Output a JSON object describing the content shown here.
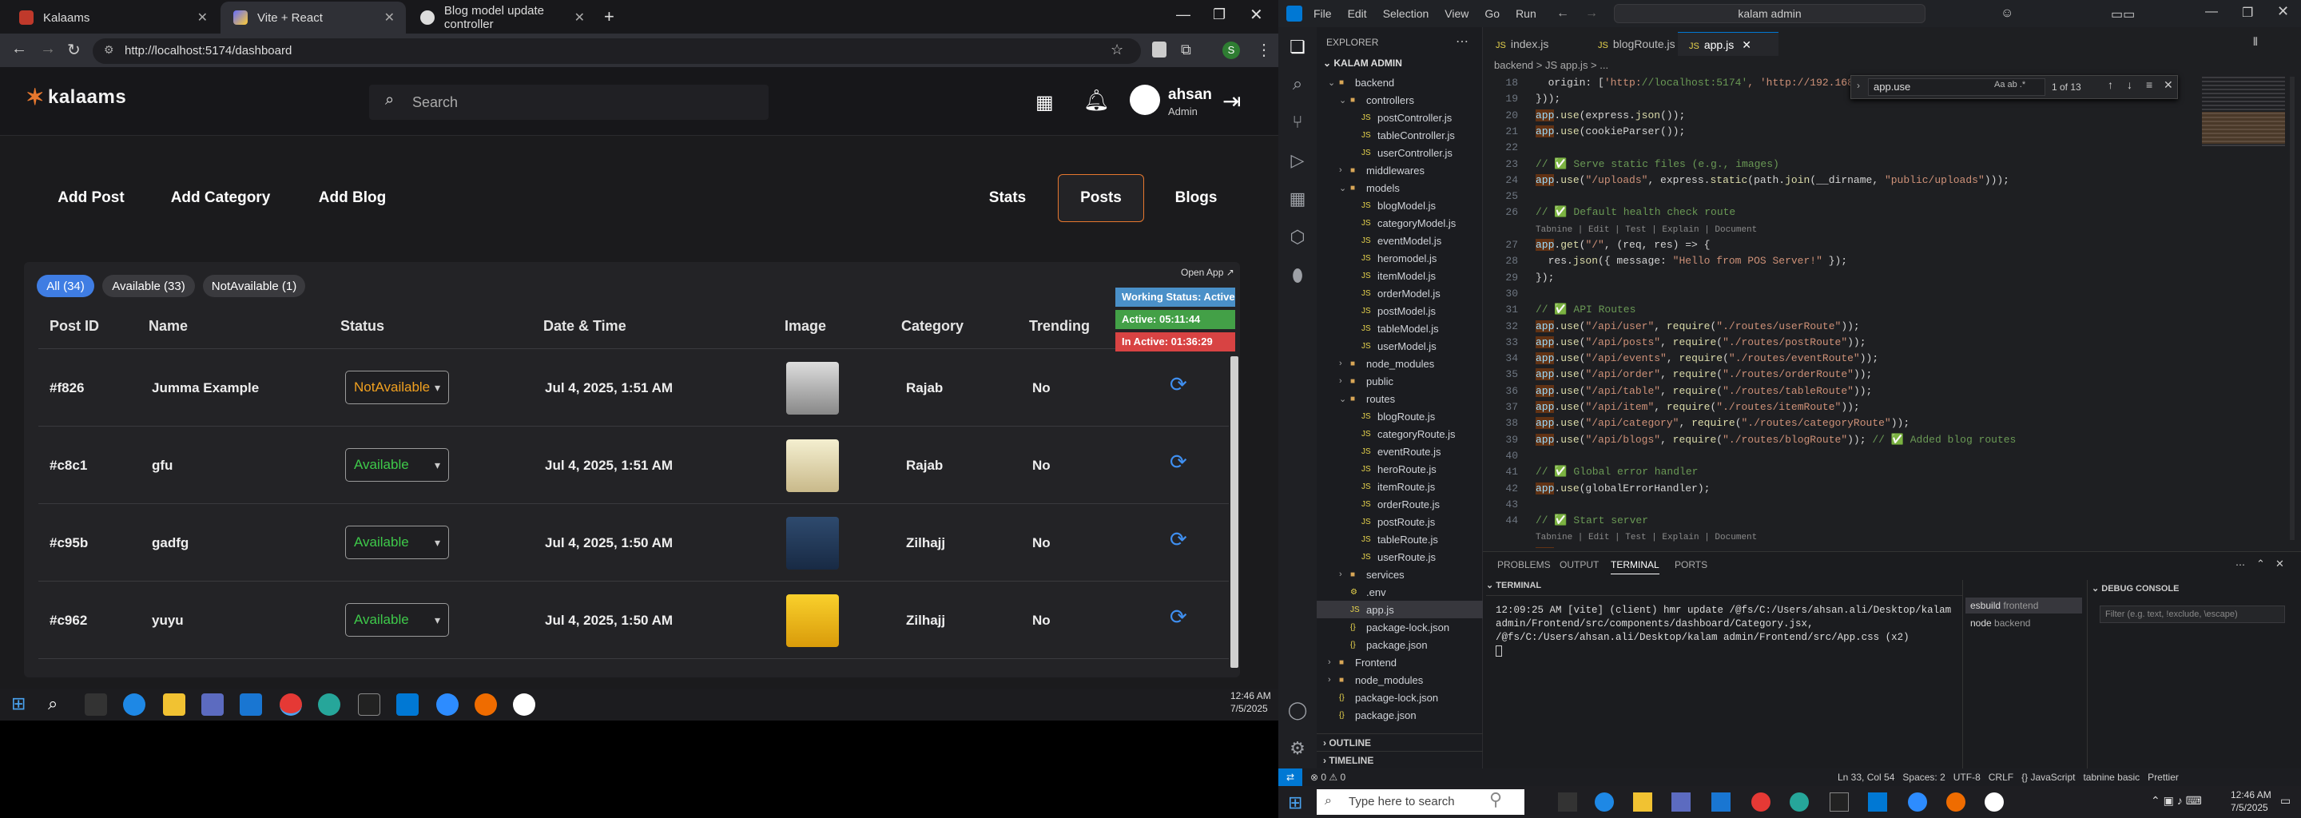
{
  "browser": {
    "tabs": [
      {
        "title": "Kalaams"
      },
      {
        "title": "Vite + React"
      },
      {
        "title": "Blog model update controller"
      }
    ],
    "url": "http://localhost:5174/dashboard"
  },
  "app": {
    "logo": "kalaams",
    "search_placeholder": "Search",
    "user": {
      "name": "ahsan",
      "role": "Admin"
    },
    "nav_left": [
      "Add Post",
      "Add Category",
      "Add Blog"
    ],
    "nav_right": [
      "Stats",
      "Posts",
      "Blogs"
    ],
    "filters": [
      "All (34)",
      "Available (33)",
      "NotAvailable (1)"
    ],
    "open_app": "Open App ↗",
    "columns": [
      "Post ID",
      "Name",
      "Status",
      "Date & Time",
      "Image",
      "Category",
      "Trending"
    ],
    "rows": [
      {
        "id": "#f826",
        "name": "Jumma Example",
        "status": "NotAvailable",
        "date": "Jul 4, 2025, 1:51 AM",
        "category": "Rajab",
        "trending": "No"
      },
      {
        "id": "#c8c1",
        "name": "gfu",
        "status": "Available",
        "date": "Jul 4, 2025, 1:51 AM",
        "category": "Rajab",
        "trending": "No"
      },
      {
        "id": "#c95b",
        "name": "gadfg",
        "status": "Available",
        "date": "Jul 4, 2025, 1:50 AM",
        "category": "Zilhajj",
        "trending": "No"
      },
      {
        "id": "#c962",
        "name": "yuyu",
        "status": "Available",
        "date": "Jul 4, 2025, 1:50 AM",
        "category": "Zilhajj",
        "trending": "No"
      }
    ],
    "working_status": "Working Status: Active",
    "active_time": "Active: 05:11:44",
    "inactive_time": "In Active: 01:36:29",
    "colors": {
      "accent": "#e6772e",
      "available": "#3ec94a",
      "not_available": "#f0a020",
      "chip": "#3f7de3"
    }
  },
  "taskbar_left": {
    "time": "12:46 AM",
    "date": "7/5/2025"
  },
  "vscode": {
    "menu": [
      "File",
      "Edit",
      "Selection",
      "View",
      "Go",
      "Run"
    ],
    "search": "kalam admin",
    "explorer_title": "EXPLORER",
    "root": "KALAM ADMIN",
    "tree": [
      {
        "label": "backend",
        "depth": 1,
        "caret": "⌄"
      },
      {
        "label": "controllers",
        "depth": 2,
        "caret": "⌄"
      },
      {
        "label": "postController.js",
        "depth": 3,
        "caret": ""
      },
      {
        "label": "tableController.js",
        "depth": 3,
        "caret": ""
      },
      {
        "label": "userController.js",
        "depth": 3,
        "caret": ""
      },
      {
        "label": "middlewares",
        "depth": 2,
        "caret": "›"
      },
      {
        "label": "models",
        "depth": 2,
        "caret": "⌄"
      },
      {
        "label": "blogModel.js",
        "depth": 3,
        "caret": ""
      },
      {
        "label": "categoryModel.js",
        "depth": 3,
        "caret": ""
      },
      {
        "label": "eventModel.js",
        "depth": 3,
        "caret": ""
      },
      {
        "label": "heromodel.js",
        "depth": 3,
        "caret": ""
      },
      {
        "label": "itemModel.js",
        "depth": 3,
        "caret": ""
      },
      {
        "label": "orderModel.js",
        "depth": 3,
        "caret": ""
      },
      {
        "label": "postModel.js",
        "depth": 3,
        "caret": ""
      },
      {
        "label": "tableModel.js",
        "depth": 3,
        "caret": ""
      },
      {
        "label": "userModel.js",
        "depth": 3,
        "caret": ""
      },
      {
        "label": "node_modules",
        "depth": 2,
        "caret": "›"
      },
      {
        "label": "public",
        "depth": 2,
        "caret": "›"
      },
      {
        "label": "routes",
        "depth": 2,
        "caret": "⌄"
      },
      {
        "label": "blogRoute.js",
        "depth": 3,
        "caret": ""
      },
      {
        "label": "categoryRoute.js",
        "depth": 3,
        "caret": ""
      },
      {
        "label": "eventRoute.js",
        "depth": 3,
        "caret": ""
      },
      {
        "label": "heroRoute.js",
        "depth": 3,
        "caret": ""
      },
      {
        "label": "itemRoute.js",
        "depth": 3,
        "caret": ""
      },
      {
        "label": "orderRoute.js",
        "depth": 3,
        "caret": ""
      },
      {
        "label": "postRoute.js",
        "depth": 3,
        "caret": ""
      },
      {
        "label": "tableRoute.js",
        "depth": 3,
        "caret": ""
      },
      {
        "label": "userRoute.js",
        "depth": 3,
        "caret": ""
      },
      {
        "label": "services",
        "depth": 2,
        "caret": "›"
      },
      {
        "label": ".env",
        "depth": 2,
        "caret": ""
      },
      {
        "label": "app.js",
        "depth": 2,
        "caret": ""
      },
      {
        "label": "package-lock.json",
        "depth": 2,
        "caret": ""
      },
      {
        "label": "package.json",
        "depth": 2,
        "caret": ""
      },
      {
        "label": "Frontend",
        "depth": 1,
        "caret": "›"
      },
      {
        "label": "node_modules",
        "depth": 1,
        "caret": "›"
      },
      {
        "label": "package-lock.json",
        "depth": 1,
        "caret": ""
      },
      {
        "label": "package.json",
        "depth": 1,
        "caret": ""
      }
    ],
    "outline": "OUTLINE",
    "timeline": "TIMELINE",
    "editor_tabs": [
      "index.js",
      "blogRoute.js",
      "app.js"
    ],
    "breadcrumb": "backend > JS app.js > ...",
    "find": {
      "query": "app.use",
      "result": "1 of 13"
    },
    "code": [
      {
        "n": "18",
        "t": "  origin: ['http://localhost:5174', 'http://192.168"
      },
      {
        "n": "19",
        "t": "}));"
      },
      {
        "n": "20",
        "t": "app.use(express.json());"
      },
      {
        "n": "21",
        "t": "app.use(cookieParser());"
      },
      {
        "n": "22",
        "t": ""
      },
      {
        "n": "23",
        "t": "// ✅ Serve static files (e.g., images)"
      },
      {
        "n": "24",
        "t": "app.use(\"/uploads\", express.static(path.join(__dirname, \"public/uploads\")));"
      },
      {
        "n": "25",
        "t": ""
      },
      {
        "n": "26",
        "t": "// ✅ Default health check route"
      },
      {
        "n": "",
        "t": "Tabnine | Edit | Test | Explain | Document"
      },
      {
        "n": "27",
        "t": "app.get(\"/\", (req, res) => {"
      },
      {
        "n": "28",
        "t": "  res.json({ message: \"Hello from POS Server!\" });"
      },
      {
        "n": "29",
        "t": "});"
      },
      {
        "n": "30",
        "t": ""
      },
      {
        "n": "31",
        "t": "// ✅ API Routes"
      },
      {
        "n": "32",
        "t": "app.use(\"/api/user\", require(\"./routes/userRoute\"));"
      },
      {
        "n": "33",
        "t": "app.use(\"/api/posts\", require(\"./routes/postRoute\"));"
      },
      {
        "n": "34",
        "t": "app.use(\"/api/events\", require(\"./routes/eventRoute\"));"
      },
      {
        "n": "35",
        "t": "app.use(\"/api/order\", require(\"./routes/orderRoute\"));"
      },
      {
        "n": "36",
        "t": "app.use(\"/api/table\", require(\"./routes/tableRoute\"));"
      },
      {
        "n": "37",
        "t": "app.use(\"/api/item\", require(\"./routes/itemRoute\"));"
      },
      {
        "n": "38",
        "t": "app.use(\"/api/category\", require(\"./routes/categoryRoute\"));"
      },
      {
        "n": "39",
        "t": "app.use(\"/api/blogs\", require(\"./routes/blogRoute\")); // ✅ Added blog routes"
      },
      {
        "n": "40",
        "t": ""
      },
      {
        "n": "41",
        "t": "// ✅ Global error handler"
      },
      {
        "n": "42",
        "t": "app.use(globalErrorHandler);"
      },
      {
        "n": "43",
        "t": ""
      },
      {
        "n": "44",
        "t": "// ✅ Start server"
      },
      {
        "n": "",
        "t": "Tabnine | Edit | Test | Explain | Document"
      },
      {
        "n": "45",
        "t": "app.listen(PORT, () => {"
      },
      {
        "n": "46",
        "t": "  console.log(`POS Server is listening on port ${PORT}`);"
      }
    ],
    "panel_tabs": [
      "PROBLEMS",
      "OUTPUT",
      "TERMINAL",
      "PORTS"
    ],
    "terminal_label": "TERMINAL",
    "terminal_text": "12:09:25 AM [vite] (client) hmr update /@fs/C:/Users/ahsan.ali/Desktop/kalam admin/Frontend/src/components/dashboard/Category.jsx, /@fs/C:/Users/ahsan.ali/Desktop/kalam admin/Frontend/src/App.css (x2)",
    "terminals": [
      {
        "name": "esbuild",
        "detail": "frontend"
      },
      {
        "name": "node",
        "detail": "backend"
      }
    ],
    "debug_console": "DEBUG CONSOLE",
    "filter_placeholder": "Filter (e.g. text, !exclude, \\escape)",
    "status_left": "⊗ 0 ⚠ 0",
    "status_right": "Ln 33, Col 54   Spaces: 2   UTF-8   CRLF   {} JavaScript   tabnine basic   Prettier"
  },
  "taskbar_right": {
    "search": "Type here to search",
    "time": "12:46 AM",
    "date": "7/5/2025"
  }
}
